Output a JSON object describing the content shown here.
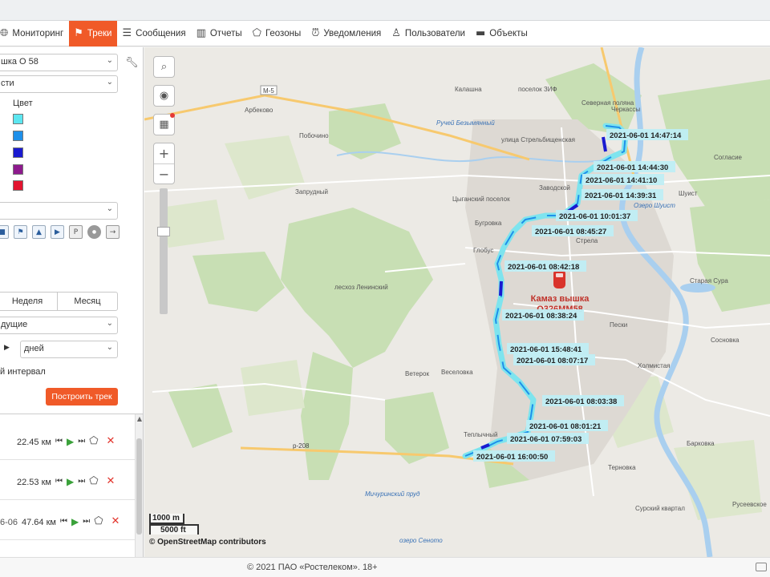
{
  "nav": {
    "items": [
      {
        "label": "Мониторинг",
        "icon": "globe-icon"
      },
      {
        "label": "Треки",
        "icon": "checkered-flag-icon",
        "active": true
      },
      {
        "label": "Сообщения",
        "icon": "message-list-icon"
      },
      {
        "label": "Отчеты",
        "icon": "bar-chart-icon"
      },
      {
        "label": "Геозоны",
        "icon": "polygon-icon"
      },
      {
        "label": "Уведомления",
        "icon": "alarm-clock-icon"
      },
      {
        "label": "Пользователи",
        "icon": "user-icon"
      },
      {
        "label": "Объекты",
        "icon": "bus-icon"
      }
    ]
  },
  "sidebar": {
    "unit_select": "шка О         58",
    "type_select": "сти",
    "color_title": "Цвет",
    "colors": [
      "#5ce6f0",
      "#1e90ea",
      "#1a1ad0",
      "#8e1a8e",
      "#e2142f"
    ],
    "third_select": "",
    "periods": [
      "Неделя",
      "Месяц"
    ],
    "mode_select": "дущие",
    "unit_small_select": "дней",
    "interval_label": "й интервал",
    "build_button": "Построить трек",
    "tracks": [
      {
        "date": "",
        "distance": "22.45 км"
      },
      {
        "date": "",
        "distance": "22.53 км"
      },
      {
        "date": "6-06",
        "distance": "47.64 км"
      }
    ]
  },
  "map": {
    "vehicle_name": "Камаз вышка",
    "vehicle_plate": "О326ММ58",
    "track_labels": [
      "2021-06-01 14:47:14",
      "2021-06-01 14:44:30",
      "2021-06-01 14:41:10",
      "2021-06-01 14:39:31",
      "2021-06-01 10:01:37",
      "2021-06-01 08:45:27",
      "2021-06-01 08:42:18",
      "2021-06-01 08:38:24",
      "2021-06-01 15:48:41",
      "2021-06-01 08:07:17",
      "2021-06-01 08:03:38",
      "2021-06-01 08:01:21",
      "2021-06-01 07:59:03",
      "2021-06-01 16:00:50"
    ],
    "place_labels": [
      "Арбеково",
      "Побочино",
      "Запрудный",
      "Ручей Безымянный",
      "Калашна",
      "поселок ЗИФ",
      "Северная поляна",
      "улица Стрельбищенская",
      "Заводской",
      "Цыганский поселок",
      "Бугровка",
      "Глобус",
      "Стрела",
      "Шуист",
      "Озеро Шуист",
      "Согласие",
      "Старая Сура",
      "Ветерок",
      "Веселовка",
      "Теплычный",
      "Терновка",
      "Барковка",
      "Сосновка",
      "Мичуринский пруд",
      "озеро Сеното",
      "Русеевское",
      "Сурский квартал",
      "лесхоз Ленинский",
      "Черкассы",
      "Пески",
      "Холмистая"
    ],
    "road_labels": [
      "М-5",
      "р-208"
    ],
    "scale_metric": "1000 m",
    "scale_imperial": "5000 ft",
    "attribution": "© OpenStreetMap contributors"
  },
  "footer": {
    "copyright": "© 2021 ПАО «Ростелеком». 18+"
  }
}
